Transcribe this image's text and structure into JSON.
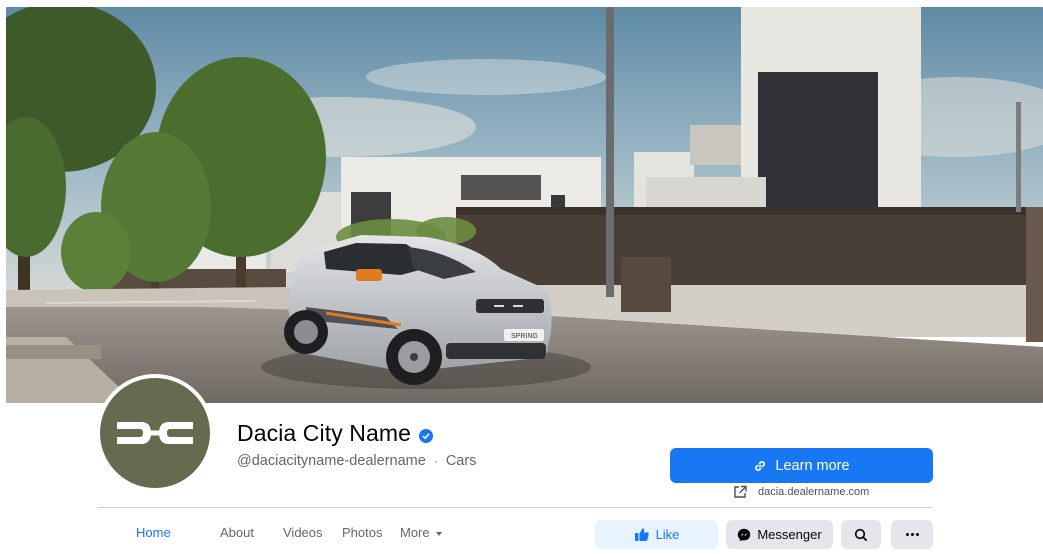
{
  "page": {
    "name": "Dacia City Name",
    "handle": "@daciacityname-dealername",
    "separator": "·",
    "category": "Cars",
    "verified": true
  },
  "cover": {
    "car_badge": "SPRING"
  },
  "cta": {
    "label": "Learn more",
    "link_text": "dacia.dealername.com",
    "icon": "link-icon",
    "color": "#1877f2"
  },
  "tabs": [
    {
      "label": "Home",
      "active": true
    },
    {
      "label": "About",
      "active": false
    },
    {
      "label": "Videos",
      "active": false
    },
    {
      "label": "Photos",
      "active": false
    },
    {
      "label": "More",
      "active": false
    }
  ],
  "actions": {
    "like_label": "Like",
    "messenger_label": "Messenger"
  },
  "colors": {
    "accent": "#1877f2",
    "avatar_bg": "#646b4f",
    "secondary_bg": "#e4e6eb",
    "like_bg": "#e7f3ff",
    "muted_text": "#65676b"
  }
}
